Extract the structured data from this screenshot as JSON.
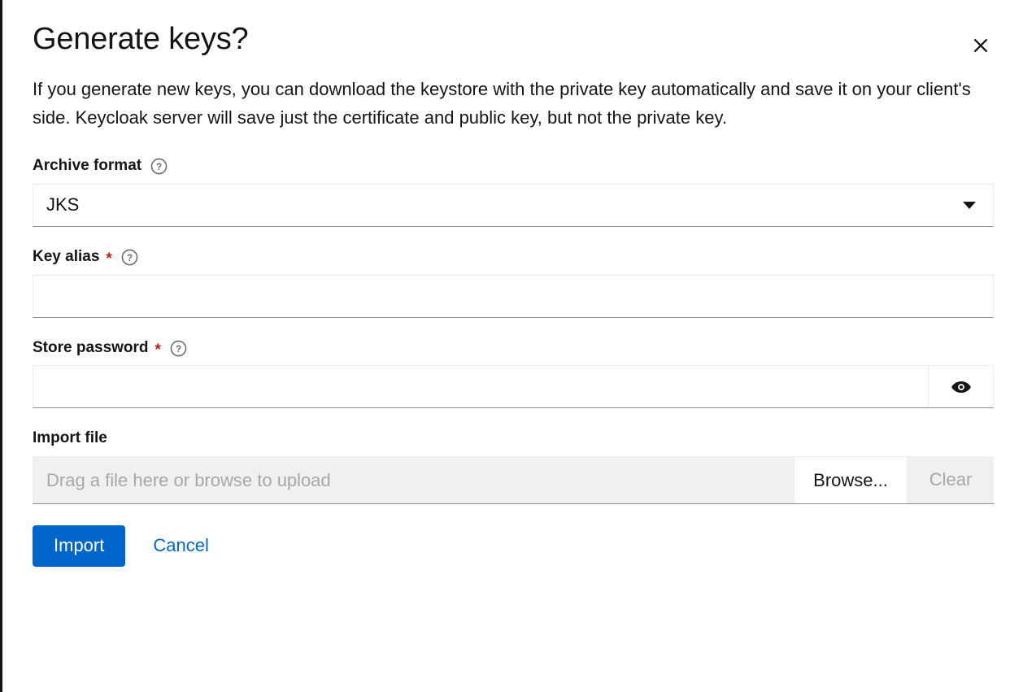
{
  "modal": {
    "title": "Generate keys?",
    "description": "If you generate new keys, you can download the keystore with the private key automatically and save it on your client's side. Keycloak server will save just the certificate and public key, but not the private key.",
    "close_label": "×"
  },
  "form": {
    "archive_format": {
      "label": "Archive format",
      "value": "JKS",
      "help_icon": "question-circle-icon",
      "caret_icon": "caret-down-icon"
    },
    "key_alias": {
      "label": "Key alias",
      "required_mark": "*",
      "value": "",
      "placeholder": "",
      "help_icon": "question-circle-icon"
    },
    "store_password": {
      "label": "Store password",
      "required_mark": "*",
      "value": "",
      "placeholder": "",
      "help_icon": "question-circle-icon",
      "reveal_icon": "eye-icon"
    },
    "import_file": {
      "label": "Import file",
      "placeholder": "Drag a file here or browse to upload",
      "value": "",
      "browse_label": "Browse...",
      "clear_label": "Clear"
    }
  },
  "footer": {
    "submit_label": "Import",
    "cancel_label": "Cancel"
  },
  "colors": {
    "primary": "#0066cc",
    "required": "#c9190b",
    "text": "#151515",
    "muted": "#a5a8ab",
    "disabled_bg": "#f0f0f0",
    "border": "#ededed",
    "border_strong": "#8a8d90"
  }
}
